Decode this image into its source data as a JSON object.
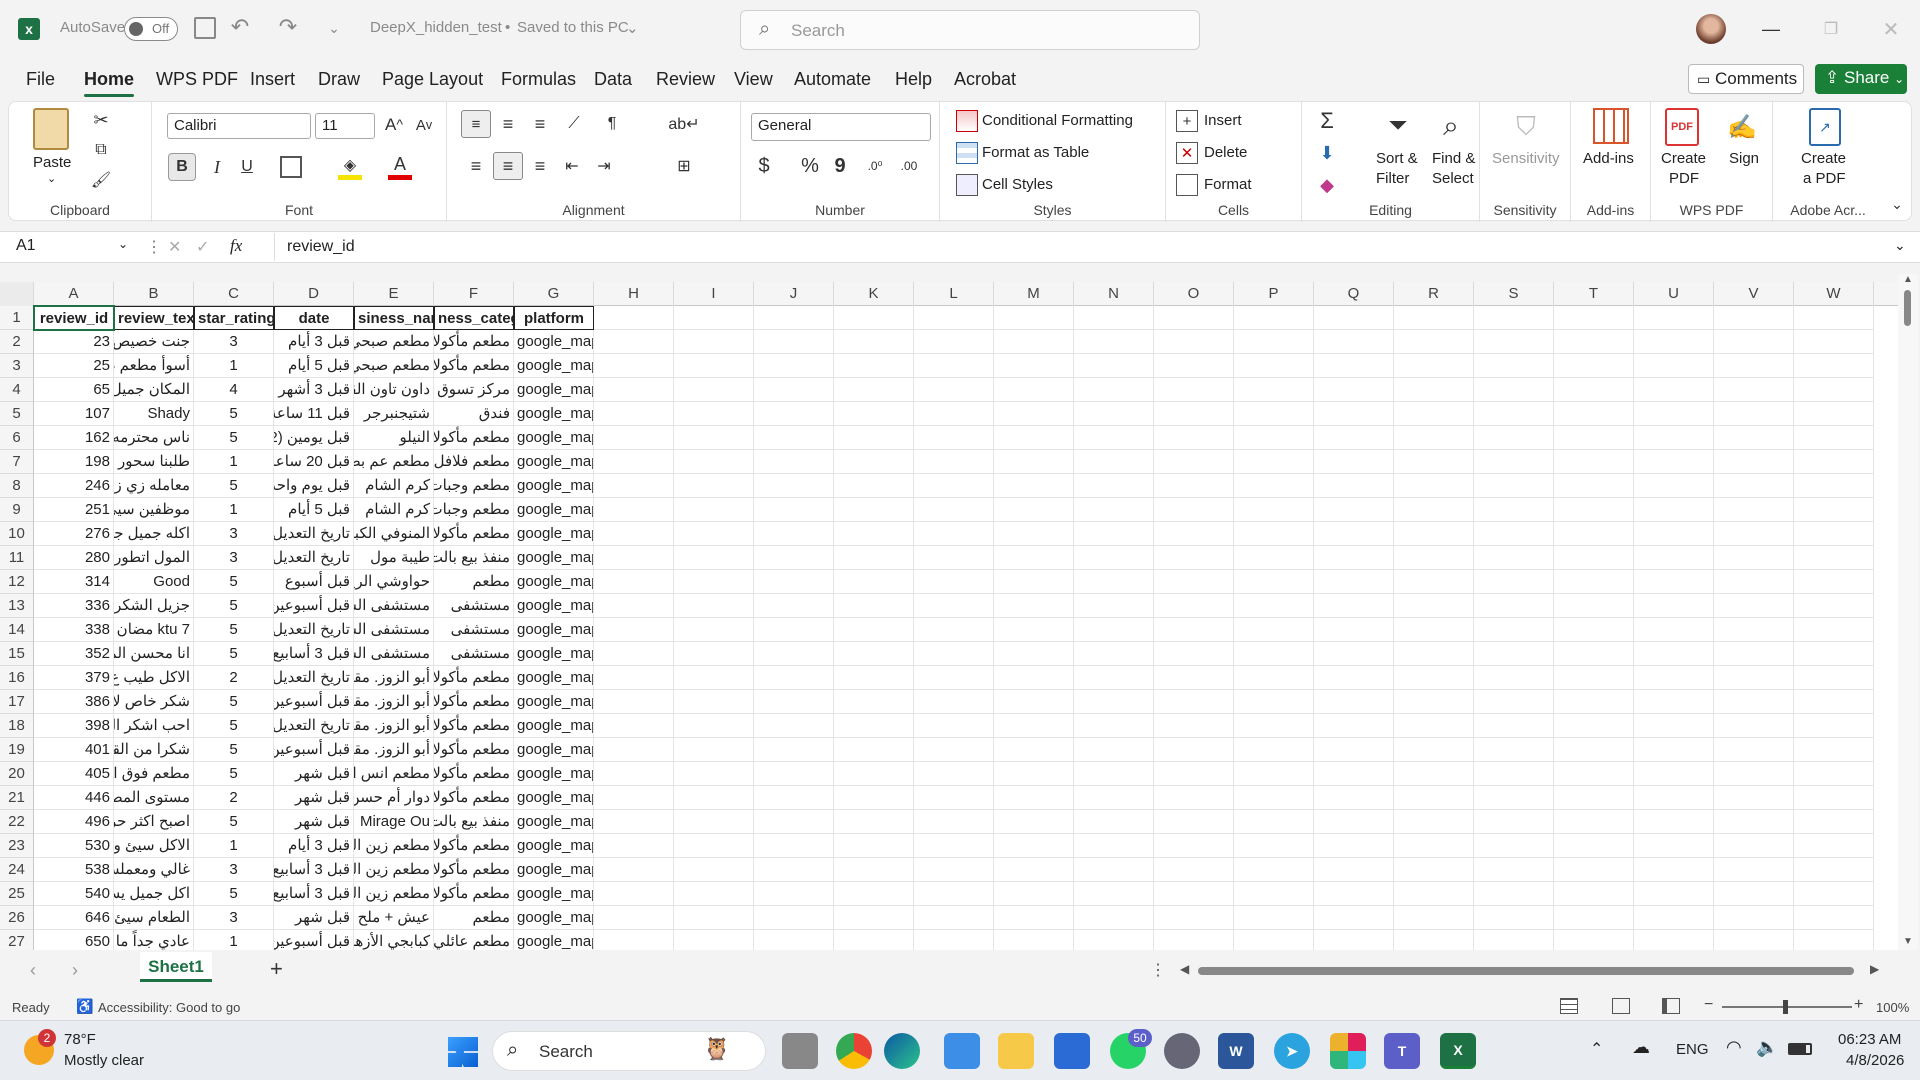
{
  "titlebar": {
    "autosave_label": "AutoSave",
    "autosave_state": "Off",
    "doc_title": "DeepX_hidden_test",
    "save_status": "Saved to this PC",
    "search_placeholder": "Search"
  },
  "menu": {
    "items": [
      "File",
      "Home",
      "WPS PDF",
      "Insert",
      "Draw",
      "Page Layout",
      "Formulas",
      "Data",
      "Review",
      "View",
      "Automate",
      "Help",
      "Acrobat"
    ],
    "active": "Home",
    "comments": "Comments",
    "share": "Share"
  },
  "ribbon": {
    "clipboard": {
      "label": "Clipboard",
      "paste": "Paste"
    },
    "font": {
      "label": "Font",
      "name": "Calibri",
      "size": "11",
      "bold": "B",
      "italic": "I",
      "underline": "U"
    },
    "alignment": {
      "label": "Alignment"
    },
    "number": {
      "label": "Number",
      "format": "General",
      "currency": "$",
      "percent": "%",
      "comma": "9"
    },
    "styles": {
      "label": "Styles",
      "conditional": "Conditional Formatting",
      "table": "Format as Table",
      "cellstyles": "Cell Styles"
    },
    "cells": {
      "label": "Cells",
      "insert": "Insert",
      "delete": "Delete",
      "format": "Format"
    },
    "editing": {
      "label": "Editing",
      "sort1": "Sort &",
      "sort2": "Filter",
      "find1": "Find &",
      "find2": "Select"
    },
    "sensitivity": {
      "label": "Sensitivity",
      "btn": "Sensitivity"
    },
    "addins": {
      "label": "Add-ins",
      "btn": "Add-ins"
    },
    "wpspdf": {
      "label": "WPS PDF",
      "create1": "Create",
      "create2": "PDF",
      "sign": "Sign"
    },
    "adobe": {
      "label": "Adobe Acr...",
      "create1": "Create",
      "create2": "a PDF"
    }
  },
  "formula_bar": {
    "name_box": "A1",
    "fx": "fx",
    "content": "review_id"
  },
  "columns": [
    "A",
    "B",
    "C",
    "D",
    "E",
    "F",
    "G",
    "H",
    "I",
    "J",
    "K",
    "L",
    "M",
    "N",
    "O",
    "P",
    "Q",
    "R",
    "S",
    "T",
    "U",
    "V",
    "W"
  ],
  "headers": [
    "review_id",
    "review_text",
    "star_rating",
    "date",
    "business_name",
    "business_category",
    "platform"
  ],
  "header_display": [
    "review_id",
    "review_tex",
    "star_rating",
    "date",
    "siness_nar",
    "ness_categ",
    "platform"
  ],
  "rows": [
    {
      "n": "2",
      "a": "23",
      "b": "جنت خصيص",
      "c": "3",
      "d": "قبل 3 أيام",
      "e": "مطعم صبحي",
      "f": "مطعم مأكولا",
      "g": "google_maps"
    },
    {
      "n": "3",
      "a": "25",
      "b": "أسوأ مطعم ط",
      "c": "1",
      "d": "قبل 5 أيام",
      "e": "مطعم صبحي",
      "f": "مطعم مأكولا",
      "g": "google_maps"
    },
    {
      "n": "4",
      "a": "65",
      "b": "المكان جميل",
      "c": "4",
      "d": "قبل 3 أشهر",
      "e": "داون تاون القا",
      "f": "مركز تسوق",
      "g": "google_maps"
    },
    {
      "n": "5",
      "a": "107",
      "b": "Shady",
      "c": "5",
      "d": "قبل 11 ساعة",
      "e": "شتيجنبرجر",
      "f": "فندق",
      "g": "google_maps"
    },
    {
      "n": "6",
      "a": "162",
      "b": "ناس محترمه",
      "c": "5",
      "d": "قبل يومين (2",
      "e": "النيلو",
      "f": "مطعم مأكولا",
      "g": "google_maps"
    },
    {
      "n": "7",
      "a": "198",
      "b": "طلبنا سحور",
      "c": "1",
      "d": "قبل 20 ساعة",
      "e": "مطعم عم بط",
      "f": "مطعم فلافل",
      "g": "google_maps"
    },
    {
      "n": "8",
      "a": "246",
      "b": "معامله زي زف",
      "c": "5",
      "d": "قبل يوم واحد",
      "e": "كرم الشام",
      "f": "مطعم وجبات",
      "g": "google_maps"
    },
    {
      "n": "9",
      "a": "251",
      "b": "موظفين سيئ",
      "c": "1",
      "d": "قبل 5 أيام",
      "e": "كرم الشام",
      "f": "مطعم وجبات",
      "g": "google_maps"
    },
    {
      "n": "10",
      "a": "276",
      "b": "اكله جميل جد",
      "c": "3",
      "d": "تاريخ التعديل",
      "e": "المنوفي الكباب",
      "f": "مطعم مأكولا",
      "g": "google_maps"
    },
    {
      "n": "11",
      "a": "280",
      "b": "المول اتطور",
      "c": "3",
      "d": "تاريخ التعديل",
      "e": "طيبة مول",
      "f": "منفذ بيع بالت",
      "g": "google_maps"
    },
    {
      "n": "12",
      "a": "314",
      "b": "Good",
      "c": "5",
      "d": "قبل أسبوع",
      "e": "حواوشي الريس",
      "f": "مطعم",
      "g": "google_maps"
    },
    {
      "n": "13",
      "a": "336",
      "b": "جزيل الشكر",
      "c": "5",
      "d": "قبل أسبوعين",
      "e": "مستشفى السا",
      "f": "مستشفى",
      "g": "google_maps"
    },
    {
      "n": "14",
      "a": "338",
      "b": "ktu 7 مضان",
      "c": "5",
      "d": "تاريخ التعديل",
      "e": "مستشفى السا",
      "f": "مستشفى",
      "g": "google_maps"
    },
    {
      "n": "15",
      "a": "352",
      "b": "انا محسن الم",
      "c": "5",
      "d": "قبل 3 أسابيع",
      "e": "مستشفى السا",
      "f": "مستشفى",
      "g": "google_maps"
    },
    {
      "n": "16",
      "a": "379",
      "b": "الاكل طيب ع",
      "c": "2",
      "d": "تاريخ التعديل",
      "e": "أبو الزوز. مقة",
      "f": "مطعم مأكولا",
      "g": "google_maps"
    },
    {
      "n": "17",
      "a": "386",
      "b": "شكر خاص لا",
      "c": "5",
      "d": "قبل أسبوعين",
      "e": "أبو الزوز. مقة",
      "f": "مطعم مأكولا",
      "g": "google_maps"
    },
    {
      "n": "18",
      "a": "398",
      "b": "احب اشكر ال",
      "c": "5",
      "d": "تاريخ التعديل",
      "e": "أبو الزوز. مقة",
      "f": "مطعم مأكولا",
      "g": "google_maps"
    },
    {
      "n": "19",
      "a": "401",
      "b": "شكرا من القل",
      "c": "5",
      "d": "قبل أسبوعين",
      "e": "أبو الزوز. مقة",
      "f": "مطعم مأكولا",
      "g": "google_maps"
    },
    {
      "n": "20",
      "a": "405",
      "b": "مطعم فوق ال",
      "c": "5",
      "d": "قبل شهر",
      "e": "مطعم انس ال",
      "f": "مطعم مأكولا",
      "g": "google_maps"
    },
    {
      "n": "21",
      "a": "446",
      "b": "مستوى المط",
      "c": "2",
      "d": "قبل شهر",
      "e": "دوار أم حسن",
      "f": "مطعم مأكولا",
      "g": "google_maps"
    },
    {
      "n": "22",
      "a": "496",
      "b": "اصبح اكثر حر",
      "c": "5",
      "d": "قبل شهر",
      "e": "Mirage Ou",
      "f": "منفذ بيع بالت",
      "g": "google_maps"
    },
    {
      "n": "23",
      "a": "530",
      "b": "الاكل سيئ وبا",
      "c": "1",
      "d": "قبل 3 أيام",
      "e": "مطعم زين الد",
      "f": "مطعم مأكولا",
      "g": "google_maps"
    },
    {
      "n": "24",
      "a": "538",
      "b": "غالي ومعملش",
      "c": "3",
      "d": "قبل 3 أسابيع",
      "e": "مطعم زين الد",
      "f": "مطعم مأكولا",
      "g": "google_maps"
    },
    {
      "n": "25",
      "a": "540",
      "b": "اكل جميل يس",
      "c": "5",
      "d": "قبل 3 أسابيع",
      "e": "مطعم زين الد",
      "f": "مطعم مأكولا",
      "g": "google_maps"
    },
    {
      "n": "26",
      "a": "646",
      "b": "الطعام سيئ ج",
      "c": "3",
      "d": "قبل شهر",
      "e": "عيش + ملح",
      "f": "مطعم",
      "g": "google_maps"
    },
    {
      "n": "27",
      "a": "650",
      "b": "عادي جداً ما",
      "c": "1",
      "d": "قبل أسبوعين",
      "e": "كبابجي الأزهر",
      "f": "مطعم عائلي",
      "g": "google_maps"
    }
  ],
  "sheets": {
    "active": "Sheet1",
    "add": "+"
  },
  "status": {
    "ready": "Ready",
    "accessibility": "Accessibility: Good to go",
    "zoom": "100%"
  },
  "taskbar": {
    "temp": "78°F",
    "weather": "Mostly clear",
    "weather_badge": "2",
    "search": "Search",
    "whatsapp_badge": "50",
    "lang": "ENG",
    "time": "06:23 AM",
    "date": "4/8/2026"
  },
  "colors": {
    "excel_green": "#1e7145",
    "share_green": "#1a7f37",
    "header_bg": "#f5f5f5"
  }
}
